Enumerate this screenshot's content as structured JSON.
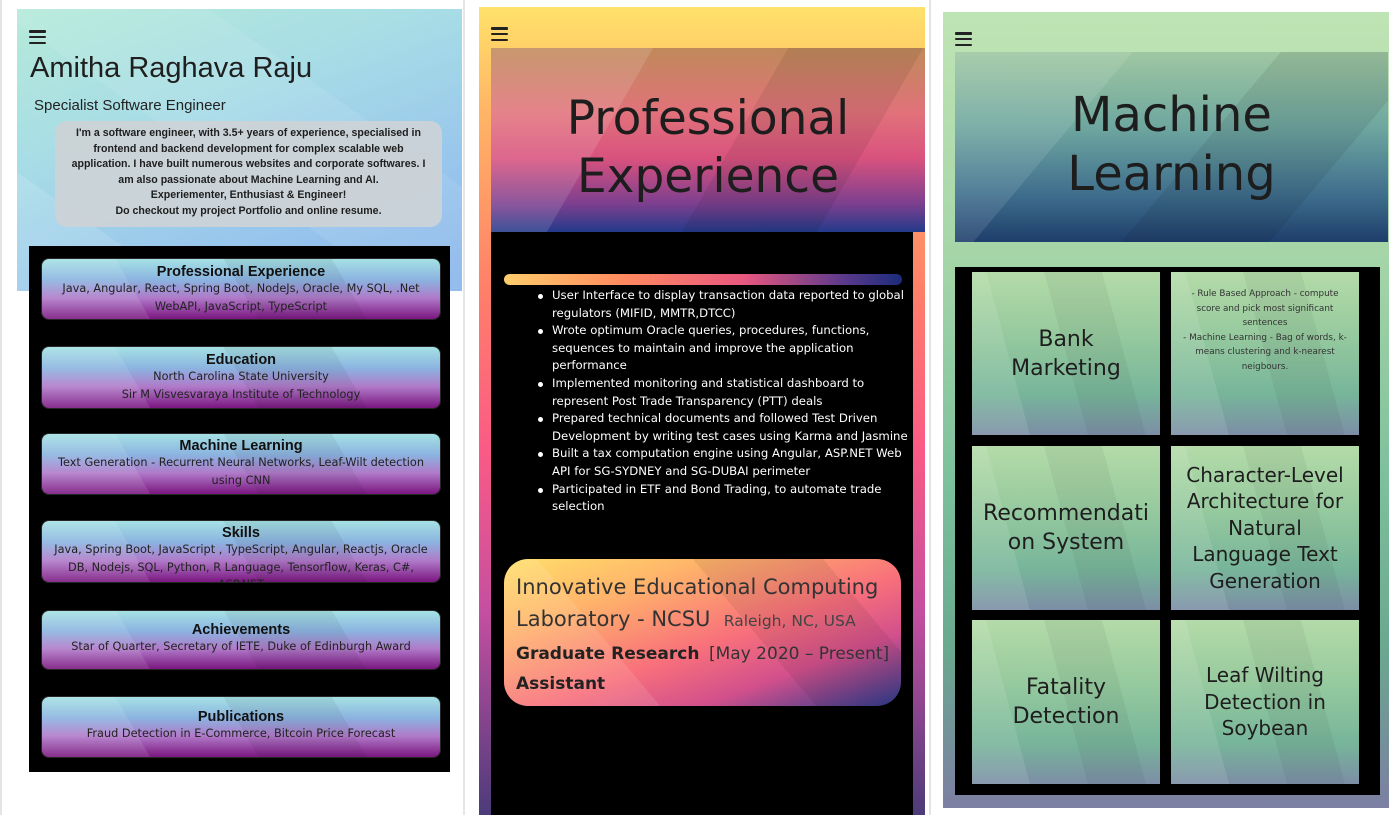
{
  "profile": {
    "name": "Amitha Raghava Raju",
    "role": "Specialist Software Engineer",
    "intro": [
      "I'm a software engineer, with 3.5+ years of experience, specialised in frontend and backend development for complex scalable web application. I have built numerous websites and corporate softwares. I am also passionate about Machine Learning and AI.",
      "Experiementer, Enthusiast & Engineer!",
      "Do checkout my project Portfolio and online resume."
    ],
    "cards": [
      {
        "title": "Professional Experience",
        "desc": "Java, Angular, React, Spring Boot, NodeJs, Oracle, My SQL, .Net WebAPI, JavaScript, TypeScript"
      },
      {
        "title": "Education",
        "desc_lines": [
          "North Carolina State University",
          "Sir M Visvesvaraya Institute of Technology"
        ]
      },
      {
        "title": "Machine Learning",
        "desc": "Text Generation - Recurrent Neural Networks, Leaf-Wilt detection using CNN"
      },
      {
        "title": "Skills",
        "desc": "Java, Spring Boot, JavaScript , TypeScript, Angular, Reactjs, Oracle DB, Nodejs, SQL, Python, R Language, Tensorflow, Keras, C#, ASP.NET"
      },
      {
        "title": "Achievements",
        "desc": "Star of Quarter, Secretary of IETE, Duke of Edinburgh Award"
      },
      {
        "title": "Publications",
        "desc": "Fraud Detection in E-Commerce, Bitcoin Price Forecast"
      }
    ]
  },
  "experience": {
    "title_line1": "Professional",
    "title_line2": "Experience",
    "bullets": [
      "User Interface to display transaction data reported to global regulators (MIFID, MMTR,DTCC)",
      "Wrote optimum Oracle queries, procedures, functions, sequences to maintain and improve the application performance",
      "Implemented monitoring and statistical dashboard to represent Post Trade Transparency (PTT) deals",
      "Prepared technical documents and followed Test Driven Development by writing test cases using Karma and Jasmine",
      "Built a tax computation engine using Angular, ASP.NET Web API for SG-SYDNEY and SG-DUBAI perimeter",
      "Participated in ETF and Bond Trading, to automate trade selection"
    ],
    "card": {
      "lab": "Innovative Educational Computing Laboratory - NCSU",
      "location": "Raleigh, NC, USA",
      "position_line1": "Graduate Research",
      "position_line2": "Assistant",
      "dates": "[May 2020 – Present]"
    }
  },
  "ml": {
    "title_line1": "Machine",
    "title_line2": "Learning",
    "tiles": [
      {
        "title_lines": [
          "Bank",
          "Marketing"
        ]
      },
      {
        "desc_lines": [
          "- Rule Based Approach - compute",
          "score and pick most significant",
          "sentences",
          "- Machine Learning - Bag of words, k-",
          "means clustering and k-nearest",
          "neigbours."
        ]
      },
      {
        "title_lines": [
          "Recommendati",
          "on System"
        ]
      },
      {
        "title_lines": [
          "Character-Level",
          "Architecture for",
          "Natural",
          "Language Text",
          "Generation"
        ]
      },
      {
        "title_lines": [
          "Fatality",
          "Detection"
        ]
      },
      {
        "title_lines": [
          "Leaf Wilting",
          "Detection in",
          "Soybean"
        ]
      }
    ]
  },
  "icons": {
    "menu": "hamburger-menu-icon"
  }
}
